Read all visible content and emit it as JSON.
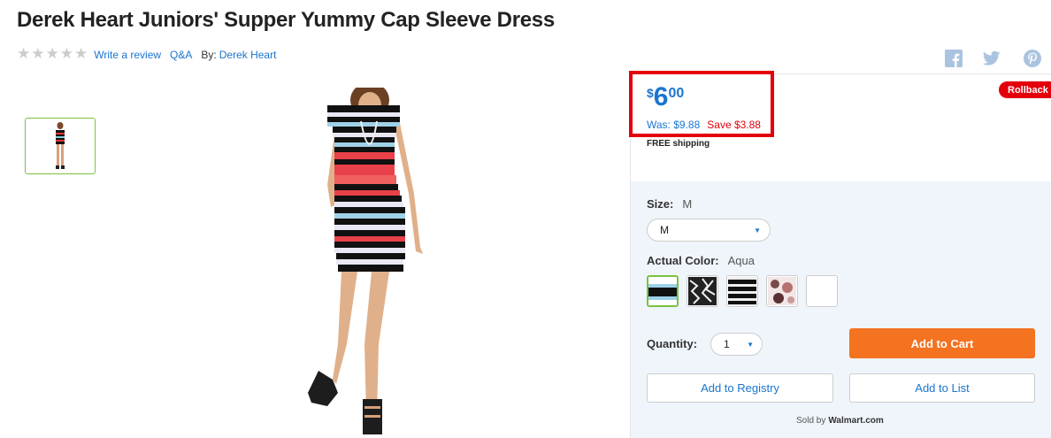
{
  "product": {
    "title": "Derek Heart Juniors' Supper Yummy Cap Sleeve Dress"
  },
  "meta": {
    "rating_stars": 5,
    "write_review": "Write a review",
    "qa": "Q&A",
    "by_label": "By:",
    "brand": "Derek Heart"
  },
  "social": {
    "icons": [
      "facebook-icon",
      "twitter-icon",
      "pinterest-icon"
    ]
  },
  "price": {
    "currency": "$",
    "dollars": "6",
    "cents": "00",
    "was": "Was: $9.88",
    "save": "Save $3.88",
    "shipping": "FREE shipping",
    "badge": "Rollback"
  },
  "options": {
    "size_label": "Size:",
    "size_value": "M",
    "size_selected": "M",
    "color_label": "Actual Color:",
    "color_value": "Aqua",
    "quantity_label": "Quantity:",
    "quantity_value": "1"
  },
  "actions": {
    "add_to_cart": "Add to Cart",
    "add_to_registry": "Add to Registry",
    "add_to_list": "Add to List"
  },
  "seller": {
    "sold_by": "Sold by",
    "name": "Walmart.com"
  },
  "colors": {
    "accent_blue": "#1a75cf",
    "rollback_red": "#e3000b",
    "cart_orange": "#f47321",
    "selected_green": "#7ac142",
    "panel_bg": "#f0f5fc"
  }
}
